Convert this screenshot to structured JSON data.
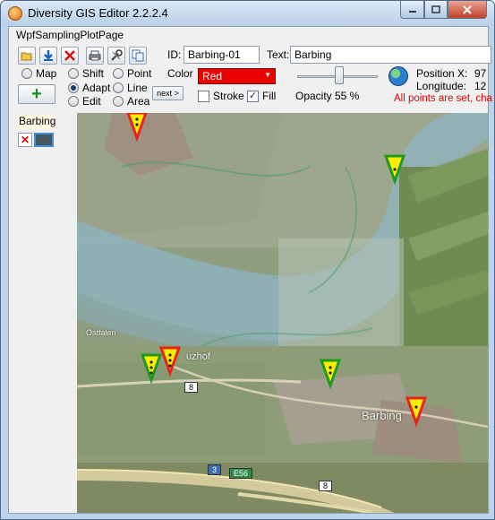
{
  "window": {
    "title": "Diversity GIS Editor 2.2.2.4",
    "minimize_icon": "minimize-icon",
    "maximize_icon": "maximize-icon",
    "close_icon": "close-icon"
  },
  "page": {
    "label": "WpfSamplingPlotPage"
  },
  "toolbar": {
    "icons": [
      "open-folder-icon",
      "save-icon",
      "delete-icon",
      "print-icon",
      "tools-icon",
      "copy-icon"
    ]
  },
  "fields": {
    "id_label": "ID:",
    "id_value": "Barbing-01",
    "text_label": "Text:",
    "text_value": "Barbing",
    "color_label": "Color",
    "color_value": "Red"
  },
  "modes": {
    "map_label": "Map",
    "shift_label": "Shift",
    "adapt_label": "Adapt",
    "edit_label": "Edit",
    "point_label": "Point",
    "line_label": "Line",
    "area_label": "Area",
    "selected_edit_mode": "Adapt"
  },
  "options": {
    "stroke_label": "Stroke",
    "stroke_checked": false,
    "fill_label": "Fill",
    "fill_checked": true
  },
  "next_button": "next >",
  "opacity": {
    "label": "Opacity",
    "value_text": "55 %",
    "value": 55
  },
  "position": {
    "x_label": "Position X:",
    "x_value": "97",
    "lon_label": "Longitude:",
    "lon_value": "12"
  },
  "status": {
    "message": "All points are set, cha",
    "color": "#e00000"
  },
  "sidebar": {
    "title": "Barbing"
  },
  "map": {
    "labels": {
      "barbing": "Barbing",
      "town_left": "Ostfalen",
      "village": "uzhof"
    },
    "road_signs": {
      "sign_8_left": "8",
      "sign_3": "3",
      "sign_e56": "E56",
      "sign_8_bottom": "8"
    },
    "marker_colors": {
      "red": "#e8231a",
      "green": "#1f9a1f",
      "yellow": "#ffee00"
    }
  }
}
